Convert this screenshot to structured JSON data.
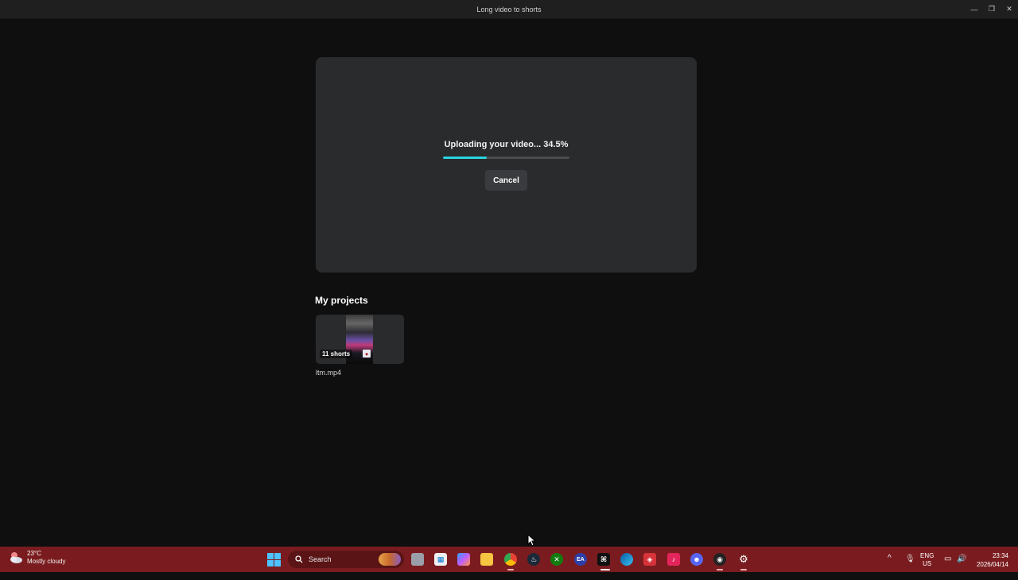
{
  "window": {
    "title": "Long video to shorts",
    "controls": [
      "minimize-icon",
      "restore-icon",
      "close-icon"
    ]
  },
  "upload": {
    "status_text": "Uploading your video... 34.5%",
    "progress_percent": 34.5,
    "cancel_label": "Cancel",
    "accent_color": "#2bd4e1"
  },
  "projects": {
    "section_title": "My projects",
    "items": [
      {
        "badge": "11 shorts",
        "name": "ltm.mp4"
      }
    ]
  },
  "taskbar": {
    "weather": {
      "temperature": "23°C",
      "description": "Mostly cloudy"
    },
    "search_label": "Search",
    "apps": [
      "task-view-icon",
      "microsoft-store-icon",
      "copilot-icon",
      "file-explorer-icon",
      "chrome-icon",
      "steam-icon",
      "xbox-icon",
      "ea-icon",
      "capcut-icon",
      "edge-icon",
      "app-icon",
      "tiktok-icon",
      "discord-icon",
      "obs-icon",
      "settings-icon"
    ],
    "language": {
      "line1": "ENG",
      "line2": "US"
    },
    "time": "23:34",
    "date": "2026/04/14"
  }
}
